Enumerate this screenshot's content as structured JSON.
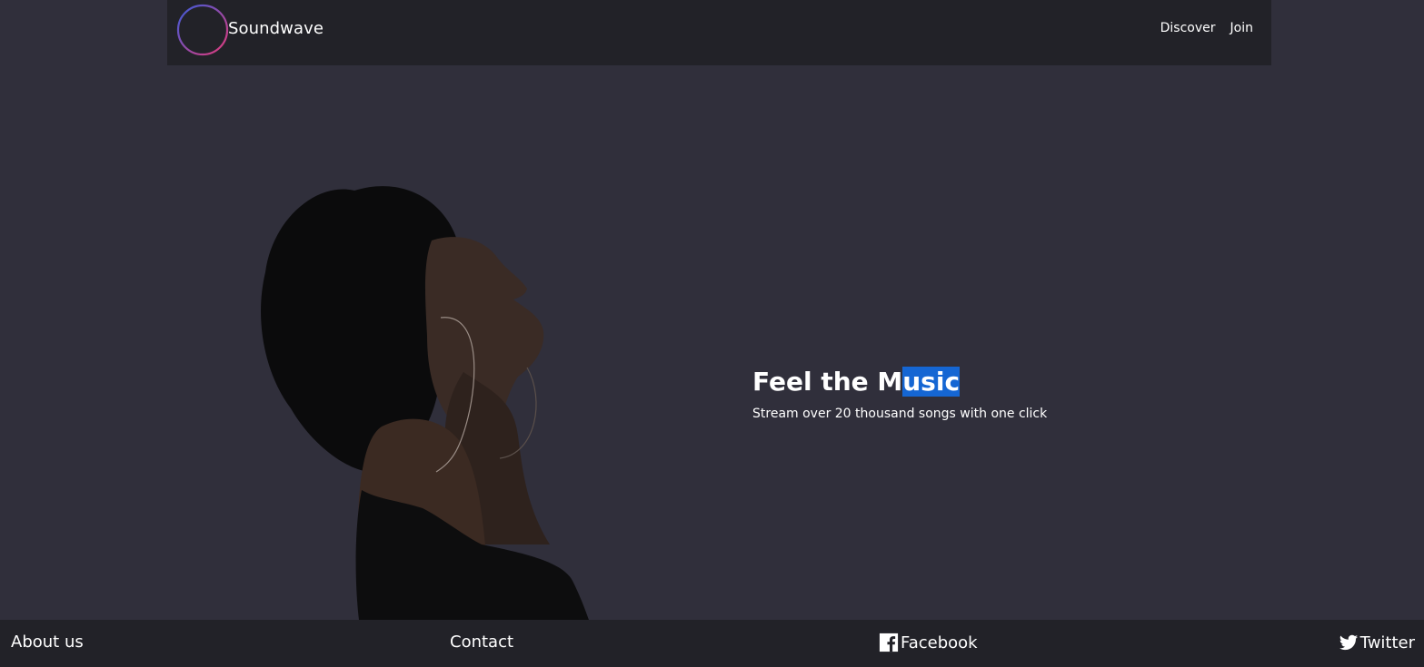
{
  "header": {
    "brand": "Soundwave",
    "nav": [
      {
        "label": "Discover"
      },
      {
        "label": "Join"
      }
    ]
  },
  "hero": {
    "title_prefix": "Feel the M",
    "title_highlight": "usic",
    "subtitle": "Stream over 20 thousand songs with one click"
  },
  "footer": {
    "about": "About us",
    "contact": "Contact",
    "facebook": "Facebook",
    "twitter": "Twitter"
  },
  "colors": {
    "background": "#302f3b",
    "header_footer": "#222228",
    "selection": "#1566d3",
    "logo_gradient_start": "#3b5bd9",
    "logo_gradient_end": "#e33a7a"
  },
  "icons": [
    "soundwave-logo-icon",
    "facebook-icon",
    "twitter-icon"
  ]
}
